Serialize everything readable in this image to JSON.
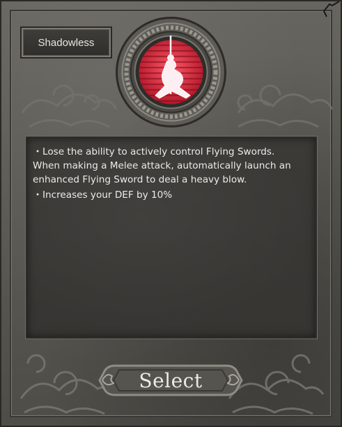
{
  "card": {
    "title": "Shadowless",
    "icon": "kneeling-swordsman-icon",
    "accent_color": "#c8283a",
    "description": [
      "Lose the ability to actively control Flying Swords.",
      "When making a Melee attack, automatically launch an",
      "enhanced Flying Sword to deal a heavy blow.",
      "Increases your DEF by 10%"
    ],
    "bullet": "・"
  },
  "actions": {
    "select_label": "Select"
  }
}
